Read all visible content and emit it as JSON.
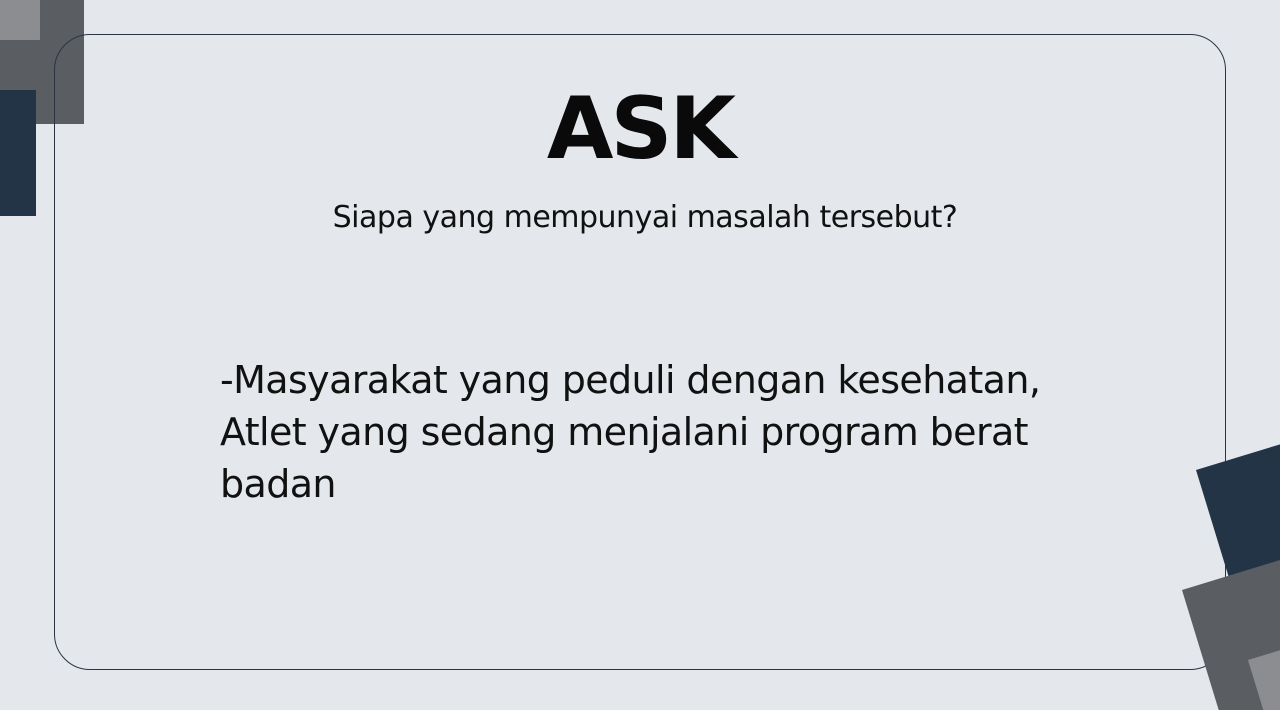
{
  "slide": {
    "title": "ASK",
    "subtitle": "Siapa yang mempunyai masalah tersebut?",
    "answer_lines": [
      "-Masyarakat yang peduli dengan kesehatan,",
      "Atlet yang sedang menjalani program berat",
      "badan"
    ]
  },
  "colors": {
    "background": "#e4e8ed",
    "frame_border": "#2c3440",
    "accent_navy": "#243447",
    "accent_gray": "#5a5d62",
    "accent_light_gray": "#8b8d90",
    "text": "#0a0a0a"
  }
}
